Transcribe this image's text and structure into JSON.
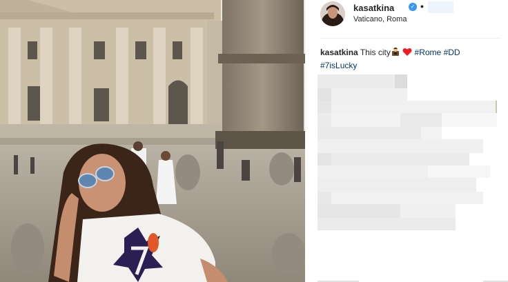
{
  "post": {
    "username": "kasatkina",
    "verified_icon": "verified-badge-icon",
    "separator": "•",
    "location": "Vaticano, Roma"
  },
  "caption": {
    "username": "kasatkina",
    "text": "This city",
    "emoji_1": "woman-with-camera-emoji",
    "emoji_2": "red-heart-emoji",
    "hashtags": [
      "#Rome",
      "#DD",
      "#7isLucky"
    ]
  },
  "colors": {
    "verified_blue": "#3897f0",
    "hashtag": "#003569",
    "heart": "#ed1c24",
    "divider": "#efefef"
  }
}
